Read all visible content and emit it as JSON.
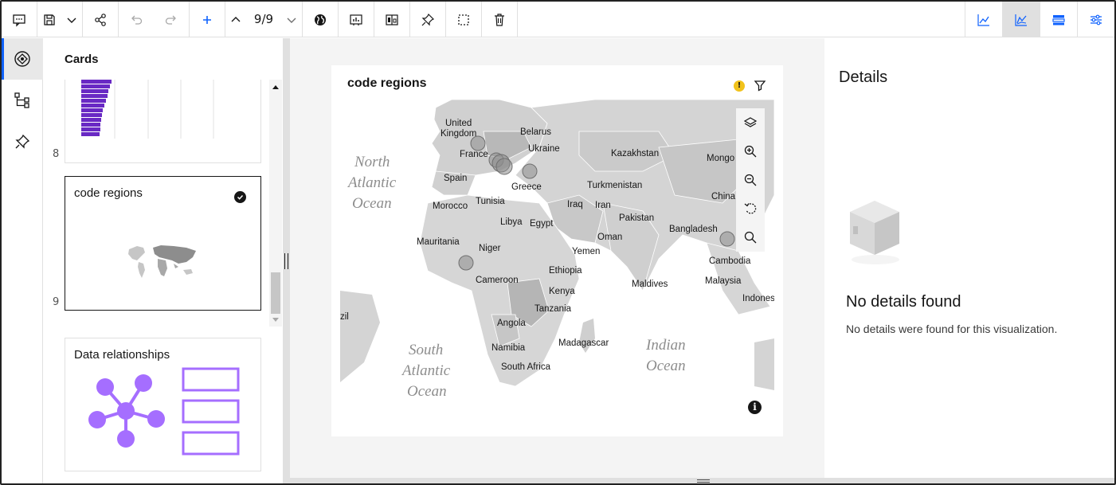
{
  "toolbar": {
    "page_indicator": "9/9",
    "left_icons": [
      "comment-icon",
      "save-icon",
      "chevron-down-icon",
      "share-icon",
      "undo-icon",
      "redo-icon",
      "add-icon",
      "chevron-up-icon",
      "chevron-down-icon",
      "globe-icon",
      "visualization-icon",
      "compare-icon",
      "pin-icon",
      "select-icon",
      "trash-icon"
    ],
    "right_icons": [
      "line-chart-icon",
      "chart-insights-icon",
      "data-table-icon",
      "settings-adjust-icon"
    ],
    "accent": "#0f62fe"
  },
  "rail": {
    "items": [
      "cards-icon",
      "hierarchy-icon",
      "pin-icon"
    ]
  },
  "cards_panel": {
    "title": "Cards",
    "cards": [
      {
        "number": "8",
        "label": ""
      },
      {
        "number": "9",
        "label": "code regions",
        "selected": true
      },
      {
        "number": "",
        "label": "Data relationships"
      }
    ]
  },
  "visualization": {
    "title": "code regions",
    "warning_symbol": "!",
    "info_symbol": "i",
    "map": {
      "ocean_labels": [
        "North Atlantic Ocean",
        "South Atlantic Ocean",
        "Indian Ocean"
      ],
      "place_labels": [
        "United Kingdom",
        "Belarus",
        "Ukraine",
        "France",
        "Kazakhstan",
        "Mongo",
        "Spain",
        "Greece",
        "Turkmenistan",
        "China",
        "Morocco",
        "Tunisia",
        "Iraq",
        "Iran",
        "Pakistan",
        "Libya",
        "Egypt",
        "Bangladesh",
        "Mauritania",
        "Oman",
        "Niger",
        "Yemen",
        "Cambodia",
        "Ethiopia",
        "Cameroon",
        "Maldives",
        "Malaysia",
        "Kenya",
        "Indones",
        "Tanzania",
        "zil",
        "Angola",
        "Madagascar",
        "Namibia",
        "South Africa"
      ]
    }
  },
  "details": {
    "title": "Details",
    "empty_title": "No details found",
    "empty_desc": "No details were found for this visualization."
  }
}
